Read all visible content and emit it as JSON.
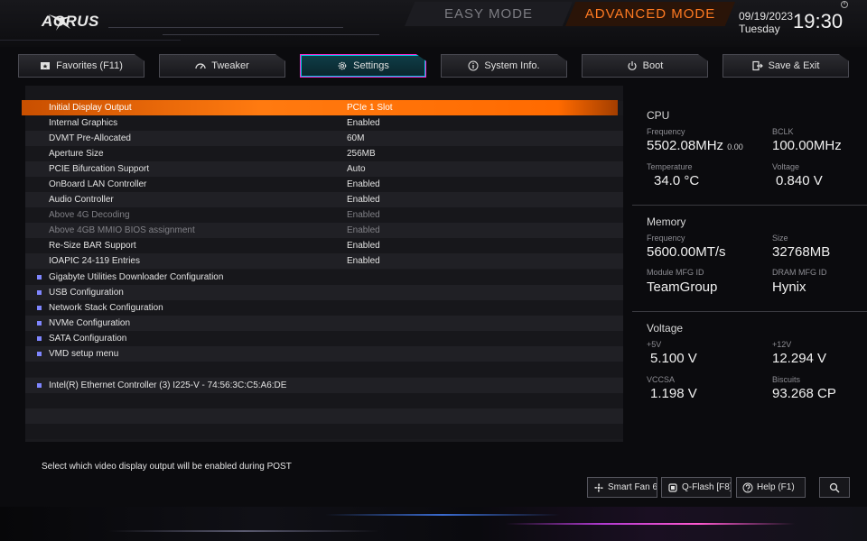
{
  "header": {
    "brand": "AORUS",
    "easy_mode": "EASY MODE",
    "advanced_mode": "ADVANCED MODE",
    "date": "09/19/2023",
    "day": "Tuesday",
    "time": "19:30"
  },
  "tabs": [
    {
      "label": "Favorites (F11)",
      "icon": "star-folder-icon"
    },
    {
      "label": "Tweaker",
      "icon": "speedometer-icon"
    },
    {
      "label": "Settings",
      "icon": "gear-icon",
      "active": true
    },
    {
      "label": "System Info.",
      "icon": "info-icon"
    },
    {
      "label": "Boot",
      "icon": "power-icon"
    },
    {
      "label": "Save & Exit",
      "icon": "exit-icon"
    }
  ],
  "settings": [
    {
      "label": "Initial Display Output",
      "value": "PCIe 1 Slot",
      "selected": true
    },
    {
      "label": "Internal Graphics",
      "value": "Enabled"
    },
    {
      "label": "DVMT Pre-Allocated",
      "value": "60M"
    },
    {
      "label": "Aperture Size",
      "value": "256MB"
    },
    {
      "label": "PCIE Bifurcation Support",
      "value": "Auto"
    },
    {
      "label": "OnBoard LAN Controller",
      "value": "Enabled"
    },
    {
      "label": "Audio Controller",
      "value": "Enabled"
    },
    {
      "label": "Above 4G Decoding",
      "value": "Enabled",
      "disabled": true
    },
    {
      "label": "Above 4GB MMIO BIOS assignment",
      "value": "Enabled",
      "disabled": true
    },
    {
      "label": "Re-Size BAR Support",
      "value": "Enabled"
    },
    {
      "label": "IOAPIC 24-119 Entries",
      "value": "Enabled"
    },
    {
      "label": "Gigabyte Utilities Downloader Configuration",
      "submenu": true
    },
    {
      "label": "USB Configuration",
      "submenu": true
    },
    {
      "label": "Network Stack Configuration",
      "submenu": true
    },
    {
      "label": "NVMe Configuration",
      "submenu": true
    },
    {
      "label": "SATA Configuration",
      "submenu": true
    },
    {
      "label": "VMD setup menu",
      "submenu": true
    },
    {
      "label": ""
    },
    {
      "label": "Intel(R) Ethernet Controller (3) I225-V - 74:56:3C:C5:A6:DE",
      "submenu": true
    }
  ],
  "info": {
    "cpu": {
      "title": "CPU",
      "frequency_label": "Frequency",
      "frequency_value": "5502.08MHz",
      "frequency_sub": "0.00",
      "bclk_label": "BCLK",
      "bclk_value": "100.00MHz",
      "temp_label": "Temperature",
      "temp_value": "34.0 °C",
      "voltage_label": "Voltage",
      "voltage_value": "0.840 V"
    },
    "memory": {
      "title": "Memory",
      "frequency_label": "Frequency",
      "frequency_value": "5600.00MT/s",
      "size_label": "Size",
      "size_value": "32768MB",
      "module_label": "Module MFG ID",
      "module_value": "TeamGroup",
      "dram_label": "DRAM MFG ID",
      "dram_value": "Hynix"
    },
    "voltage": {
      "title": "Voltage",
      "v5_label": "+5V",
      "v5_value": "5.100 V",
      "v12_label": "+12V",
      "v12_value": "12.294 V",
      "vccsa_label": "VCCSA",
      "vccsa_value": "1.198 V",
      "biscuits_label": "Biscuits",
      "biscuits_value": "93.268 CP"
    }
  },
  "help_text": "Select which video display output will be enabled during POST",
  "bottom_buttons": {
    "smart_fan": "Smart Fan 6 [F",
    "qflash": "Q-Flash [F8]",
    "help": "Help (F1)"
  },
  "colors": {
    "accent": "#ff7a10",
    "active_tab_border": "#ff2ad0",
    "submenu_bullet": "#7f86ff"
  }
}
